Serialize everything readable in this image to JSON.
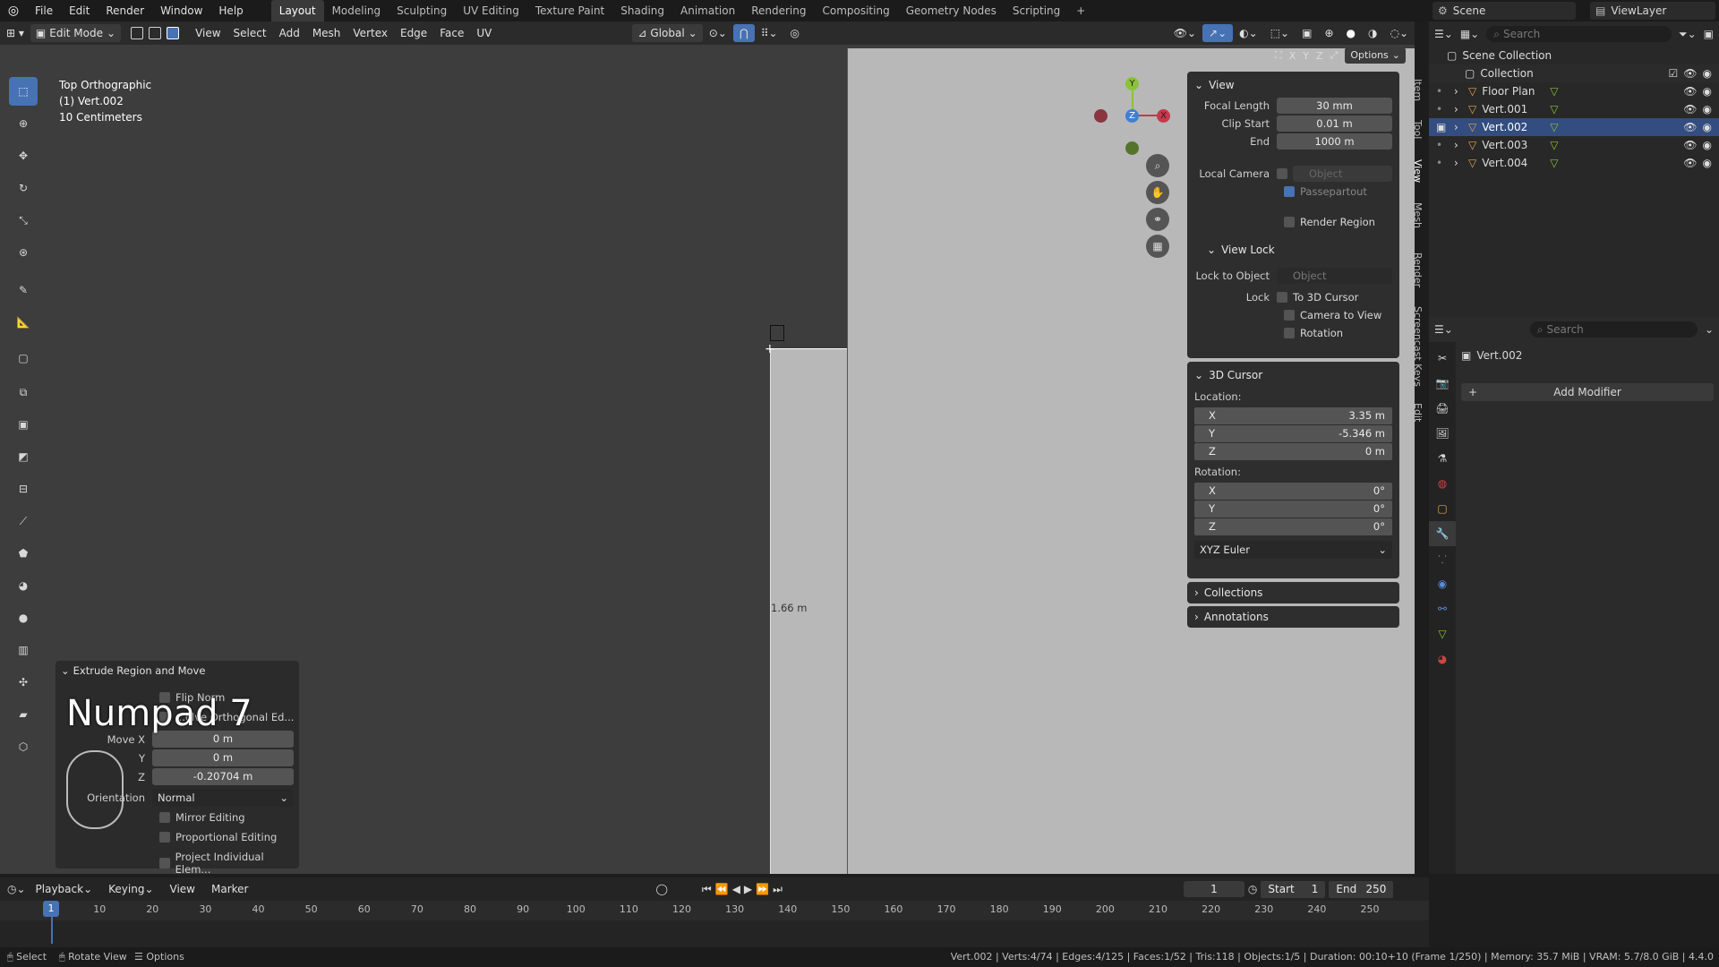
{
  "topbar": {
    "menus": [
      "File",
      "Edit",
      "Render",
      "Window",
      "Help"
    ],
    "workspaces": [
      "Layout",
      "Modeling",
      "Sculpting",
      "UV Editing",
      "Texture Paint",
      "Shading",
      "Animation",
      "Rendering",
      "Compositing",
      "Geometry Nodes",
      "Scripting"
    ],
    "active_workspace": "Layout",
    "add_tab": "+",
    "scene": "Scene",
    "view_layer": "ViewLayer"
  },
  "viewport_header": {
    "mode": "Edit Mode",
    "menus": [
      "View",
      "Select",
      "Add",
      "Mesh",
      "Vertex",
      "Edge",
      "Face",
      "UV"
    ],
    "orientation": "Global",
    "options_label": "Options",
    "axes": [
      "X",
      "Y",
      "Z"
    ]
  },
  "viewport": {
    "view_name": "Top Orthographic",
    "object": "(1) Vert.002",
    "scale": "10 Centimeters",
    "dimension_label": "1.66 m",
    "gizmo": {
      "y": "Y",
      "z": "Z",
      "x": "X"
    }
  },
  "npanel": {
    "view": {
      "title": "View",
      "focal_length_label": "Focal Length",
      "focal_length": "30 mm",
      "clip_start_label": "Clip Start",
      "clip_start": "0.01 m",
      "end_label": "End",
      "end": "1000 m",
      "local_camera_label": "Local Camera",
      "local_camera_placeholder": "Object",
      "passepartout": "Passepartout",
      "render_region": "Render Region"
    },
    "view_lock": {
      "title": "View Lock",
      "lock_to_object_label": "Lock to Object",
      "lock_to_object_placeholder": "Object",
      "lock_label": "Lock",
      "to_3d_cursor": "To 3D Cursor",
      "camera_to_view": "Camera to View",
      "rotation": "Rotation"
    },
    "cursor": {
      "title": "3D Cursor",
      "location_label": "Location:",
      "loc": [
        {
          "axis": "X",
          "value": "3.35 m"
        },
        {
          "axis": "Y",
          "value": "-5.346 m"
        },
        {
          "axis": "Z",
          "value": "0 m"
        }
      ],
      "rotation_label": "Rotation:",
      "rot": [
        {
          "axis": "X",
          "value": "0°"
        },
        {
          "axis": "Y",
          "value": "0°"
        },
        {
          "axis": "Z",
          "value": "0°"
        }
      ],
      "rotation_mode": "XYZ Euler"
    },
    "collections": "Collections",
    "annotations": "Annotations",
    "tabs": [
      "Item",
      "Tool",
      "View",
      "Mesh",
      "Render",
      "Screencast Keys",
      "Edit"
    ]
  },
  "outliner": {
    "search_placeholder": "Search",
    "scene_collection": "Scene Collection",
    "collection": "Collection",
    "items": [
      "Floor Plan",
      "Vert.001",
      "Vert.002",
      "Vert.003",
      "Vert.004"
    ],
    "selected": "Vert.002"
  },
  "properties": {
    "search_placeholder": "Search",
    "object_name": "Vert.002",
    "add_modifier": "Add Modifier"
  },
  "operator": {
    "title": "Extrude Region and Move",
    "flip_normals": "Flip Norm",
    "dissolve": "...olve Orthogonal Ed...",
    "move_label": "Move X",
    "y_label": "Y",
    "z_label": "Z",
    "move_x": "0 m",
    "move_y": "0 m",
    "move_z": "-0.20704 m",
    "orientation_label": "Orientation",
    "orientation": "Normal",
    "mirror": "Mirror Editing",
    "proportional": "Proportional Editing",
    "project": "Project Individual Elem...",
    "key_overlay": "Numpad 7"
  },
  "timeline": {
    "menus": [
      "Playback",
      "Keying",
      "View",
      "Marker"
    ],
    "current_frame": "1",
    "start_label": "Start",
    "start": "1",
    "end_label": "End",
    "end": "250",
    "ticks": [
      "1",
      "10",
      "20",
      "30",
      "40",
      "50",
      "60",
      "70",
      "80",
      "90",
      "100",
      "110",
      "120",
      "130",
      "140",
      "150",
      "160",
      "170",
      "180",
      "190",
      "200",
      "210",
      "220",
      "230",
      "240",
      "250"
    ]
  },
  "statusbar": {
    "select": "Select",
    "rotate": "Rotate View",
    "options": "Options",
    "stats": "Vert.002 | Verts:4/74 | Edges:4/125 | Faces:1/52 | Tris:118 | Objects:1/5 | Duration: 00:10+10 (Frame 1/250) | Memory: 35.7 MiB | VRAM: 5.7/8.0 GiB | 4.4.0"
  },
  "colors": {
    "accent": "#4772b3",
    "x_axis": "#c8384b",
    "y_axis": "#8ac33a",
    "z_axis": "#3f7fd8"
  }
}
